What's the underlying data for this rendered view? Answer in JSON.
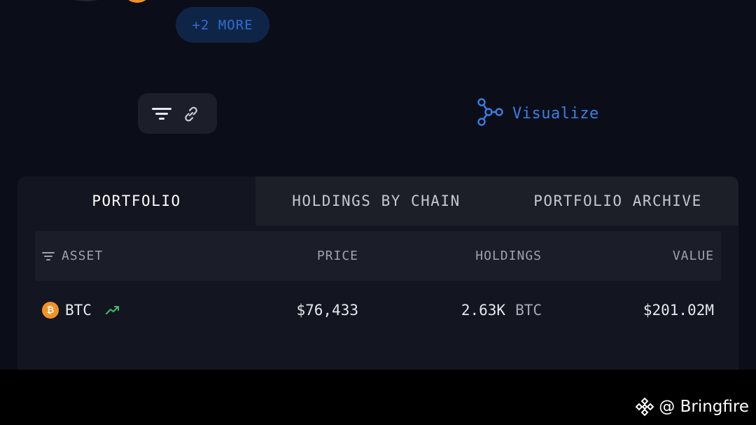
{
  "header": {
    "more_label": "+2 MORE",
    "visualize_label": "Visualize",
    "icons": {
      "filter": "filter-icon",
      "link": "link-icon",
      "visualize": "network-graph-icon"
    }
  },
  "tabs": [
    {
      "label": "PORTFOLIO",
      "active": true
    },
    {
      "label": "HOLDINGS BY CHAIN",
      "active": false
    },
    {
      "label": "PORTFOLIO ARCHIVE",
      "active": false
    }
  ],
  "table": {
    "columns": [
      "ASSET",
      "PRICE",
      "HOLDINGS",
      "VALUE"
    ],
    "rows": [
      {
        "asset": "BTC",
        "asset_icon": "bitcoin-icon",
        "trend_icon": "trend-up-icon",
        "price": "$76,433",
        "holdings_amount": "2.63K",
        "holdings_unit": "BTC",
        "value": "$201.02M"
      }
    ]
  },
  "watermark": {
    "text": "@ Bringfire",
    "icon": "binance-logo-icon"
  },
  "colors": {
    "background": "#0b0e18",
    "panel": "#131620",
    "accent_blue": "#3a7ee4",
    "btc_orange": "#f0922a",
    "trend_green": "#3fbf6a"
  }
}
